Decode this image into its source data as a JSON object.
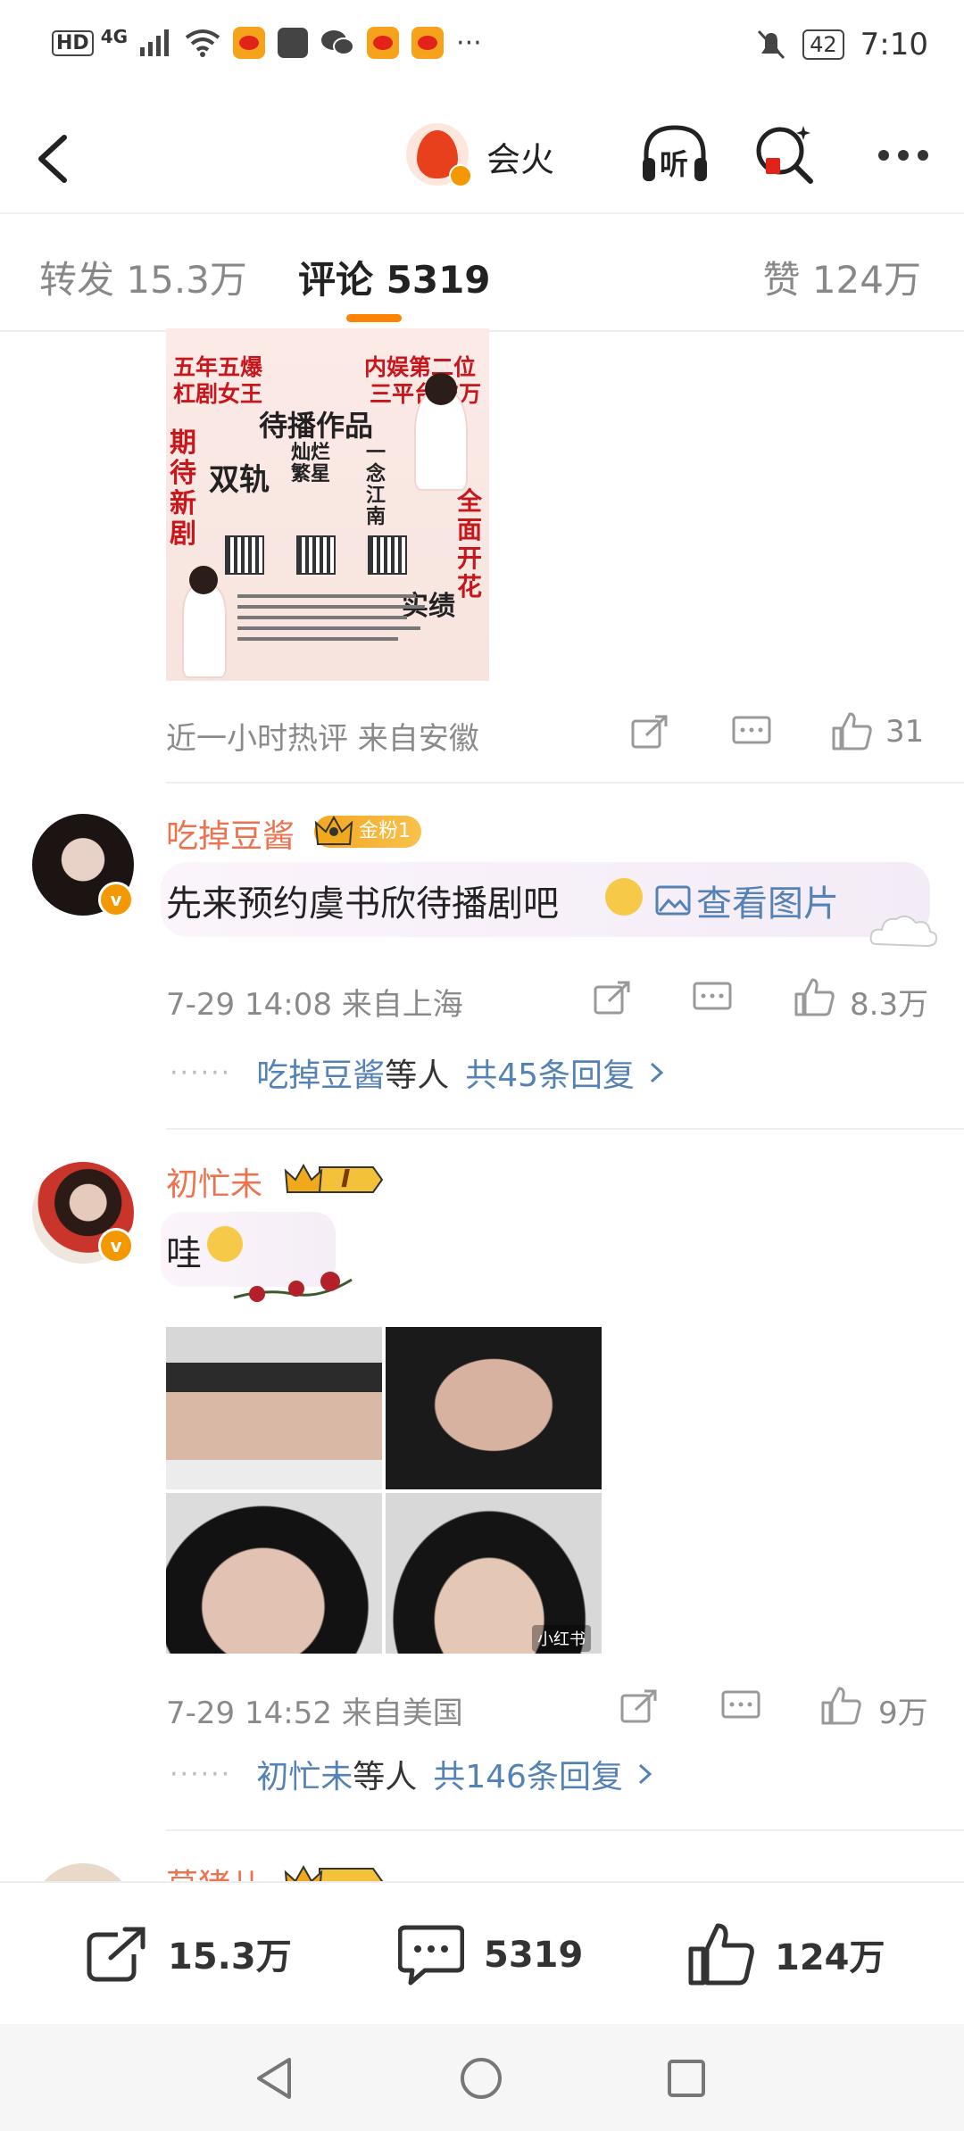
{
  "status_bar": {
    "network": "HD",
    "signal": "4G",
    "time": "7:10",
    "battery": "42"
  },
  "header": {
    "brand": "会火",
    "listen_label": "听"
  },
  "tabs": {
    "repost_label": "转发",
    "repost_count": "15.3万",
    "comment_label": "评论",
    "comment_count": "5319",
    "like_label": "赞",
    "like_count": "124万"
  },
  "poster": {
    "line1": "五年五爆",
    "line2": "杠剧女王",
    "line3": "内娱第二位",
    "line4": "三平台破万",
    "title": "待播作品",
    "side_left": "期待新剧",
    "side_right": "全面开花",
    "work1": "双轨",
    "work2": "灿烂繁星",
    "work3": "一念江南",
    "record": "实绩"
  },
  "comment0": {
    "meta": "近一小时热评 来自安徽",
    "likes": "31"
  },
  "comment1": {
    "user": "吃掉豆酱",
    "badge": "金粉1",
    "text": "先来预约虞书欣待播剧吧",
    "view_image": "查看图片",
    "meta": "7-29 14:08 来自上海",
    "likes": "8.3万",
    "reply_user": "吃掉豆酱",
    "reply_mid": "等人",
    "reply_count": "共45条回复"
  },
  "comment2": {
    "user": "初忙未",
    "badge": "I",
    "text": "哇",
    "watermark": "小红书",
    "meta": "7-29 14:52 来自美国",
    "likes": "9万",
    "reply_user": "初忙未",
    "reply_mid": "等人",
    "reply_count": "共146条回复"
  },
  "comment3": {
    "user": "莫猪儿"
  },
  "bottom_bar": {
    "repost": "15.3万",
    "comment": "5319",
    "like": "124万"
  },
  "colors": {
    "accent": "#ff8200",
    "username": "#eb7350",
    "link": "#5582b5"
  }
}
